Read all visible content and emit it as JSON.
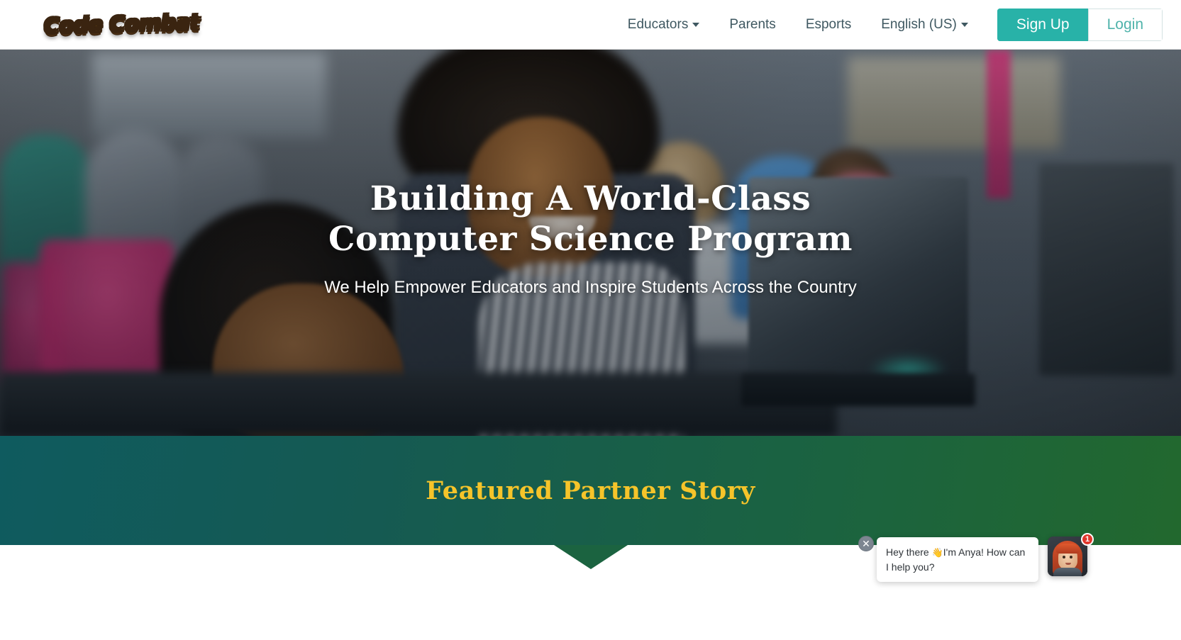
{
  "brand": {
    "logo_text": "Code Combat",
    "logo_name": "codecombat-logo"
  },
  "header": {
    "nav_items": [
      {
        "label": "Educators",
        "has_caret": true,
        "name": "educators"
      },
      {
        "label": "Parents",
        "has_caret": false,
        "name": "parents"
      },
      {
        "label": "Esports",
        "has_caret": false,
        "name": "esports"
      },
      {
        "label": "English (US)",
        "has_caret": true,
        "name": "language"
      }
    ],
    "signup_label": "Sign Up",
    "login_label": "Login",
    "accent_color": "#28b2a8",
    "login_text_color": "#4fb3ab",
    "nav_text_color": "#3f5861"
  },
  "hero": {
    "title_line1": "Building A World-Class",
    "title_line2": "Computer Science Program",
    "subtitle": "We Help Empower Educators and Inspire Students Across the Country"
  },
  "band": {
    "title": "Featured Partner Story",
    "title_color": "#f6c42a",
    "gradient_from": "#0f5b5f",
    "gradient_to": "#22682e"
  },
  "chat": {
    "message_part1": "Hey there ",
    "wave_emoji": "👋",
    "message_part2": "I'm Anya! How can I help you?",
    "close_glyph": "✕",
    "badge_count": "1",
    "badge_color": "#e0362c"
  }
}
